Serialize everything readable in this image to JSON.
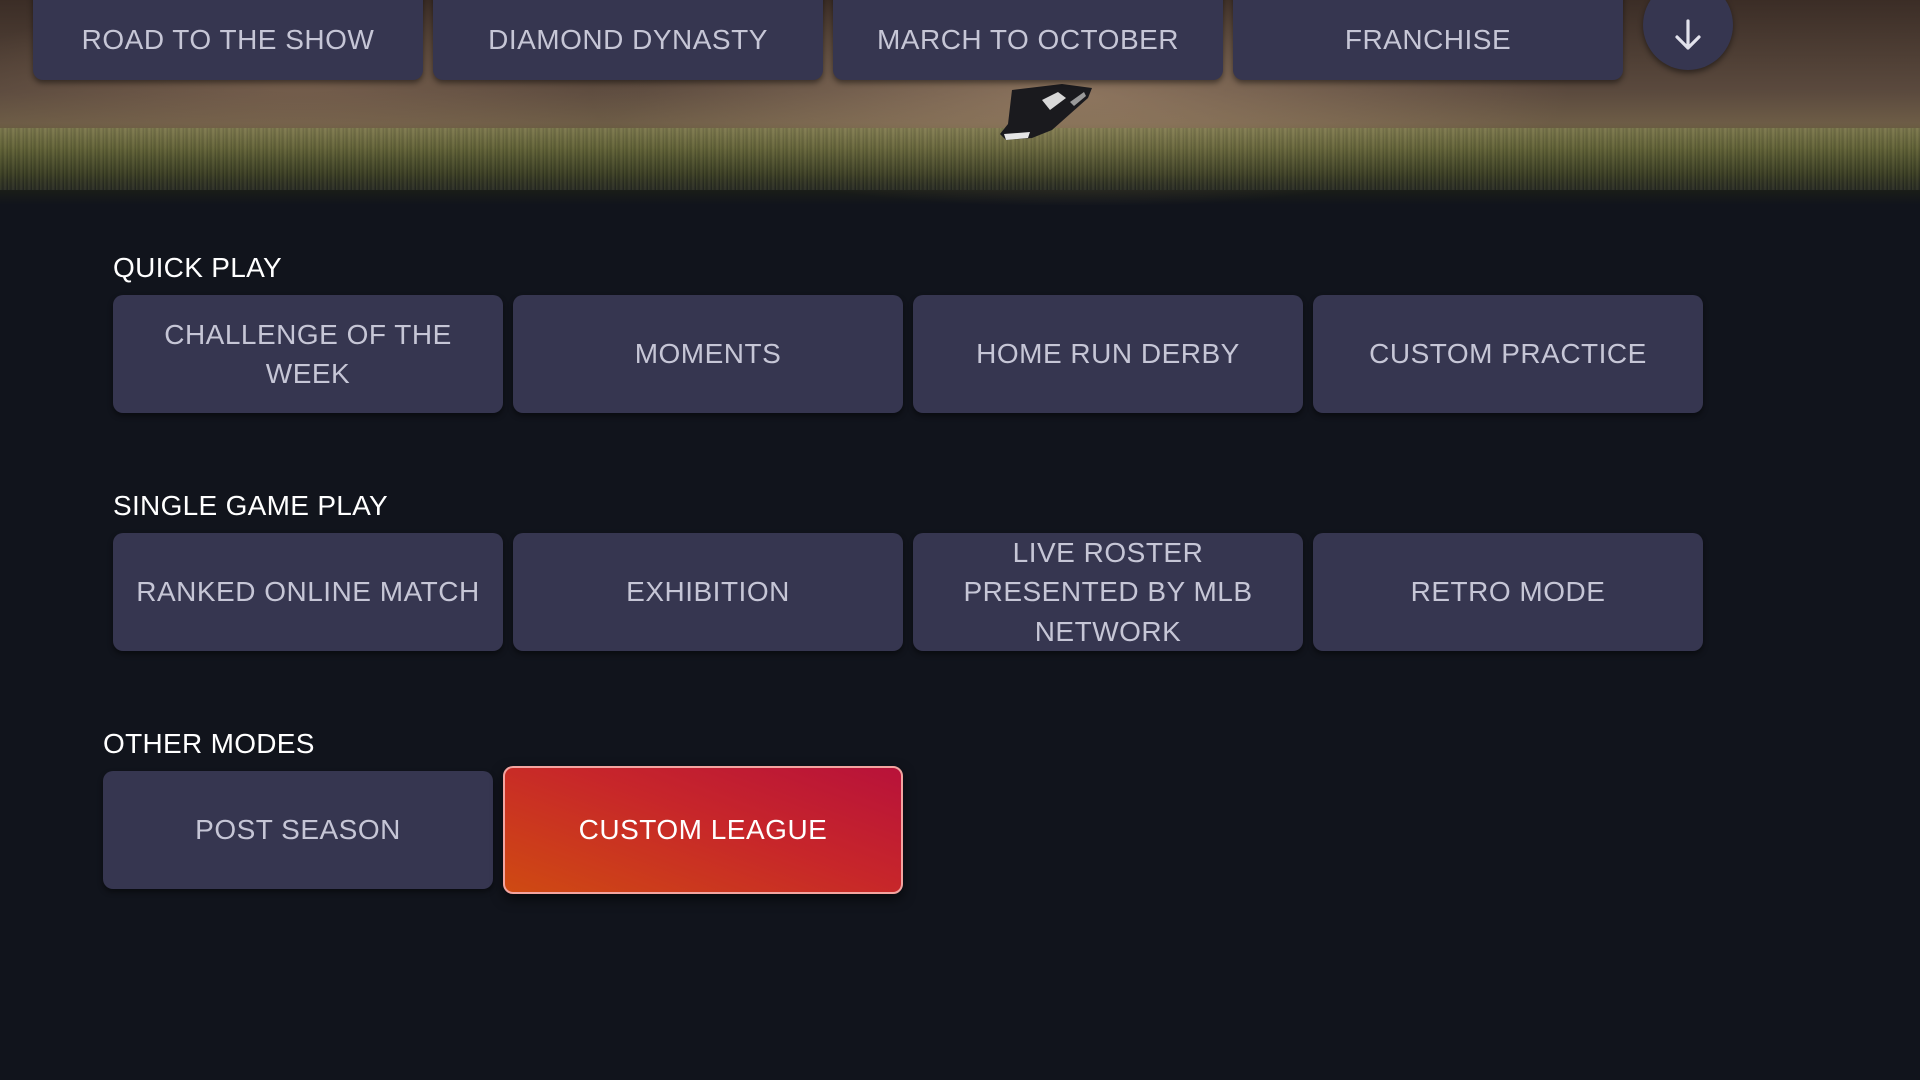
{
  "top_nav": {
    "items": [
      {
        "label": "ROAD TO THE SHOW"
      },
      {
        "label": "DIAMOND DYNASTY"
      },
      {
        "label": "MARCH TO OCTOBER"
      },
      {
        "label": "FRANCHISE"
      }
    ],
    "scroll_icon": "arrow-down-icon"
  },
  "sections": {
    "quick_play": {
      "title": "QUICK PLAY",
      "items": [
        {
          "label": "CHALLENGE OF THE WEEK"
        },
        {
          "label": "MOMENTS"
        },
        {
          "label": "HOME RUN DERBY"
        },
        {
          "label": "CUSTOM PRACTICE"
        }
      ]
    },
    "single_game_play": {
      "title": "SINGLE GAME PLAY",
      "items": [
        {
          "label": "RANKED ONLINE MATCH"
        },
        {
          "label": "EXHIBITION"
        },
        {
          "label": "LIVE ROSTER PRESENTED BY MLB NETWORK"
        },
        {
          "label": "RETRO MODE"
        }
      ]
    },
    "other_modes": {
      "title": "OTHER MODES",
      "items": [
        {
          "label": "POST SEASON"
        },
        {
          "label": "CUSTOM LEAGUE",
          "selected": true
        }
      ]
    }
  },
  "colors": {
    "background": "#11141c",
    "tile": "#363650",
    "tile_text": "#c6c6d6",
    "selected_gradient_start": "#b8123a",
    "selected_gradient_end": "#cf4a12"
  }
}
